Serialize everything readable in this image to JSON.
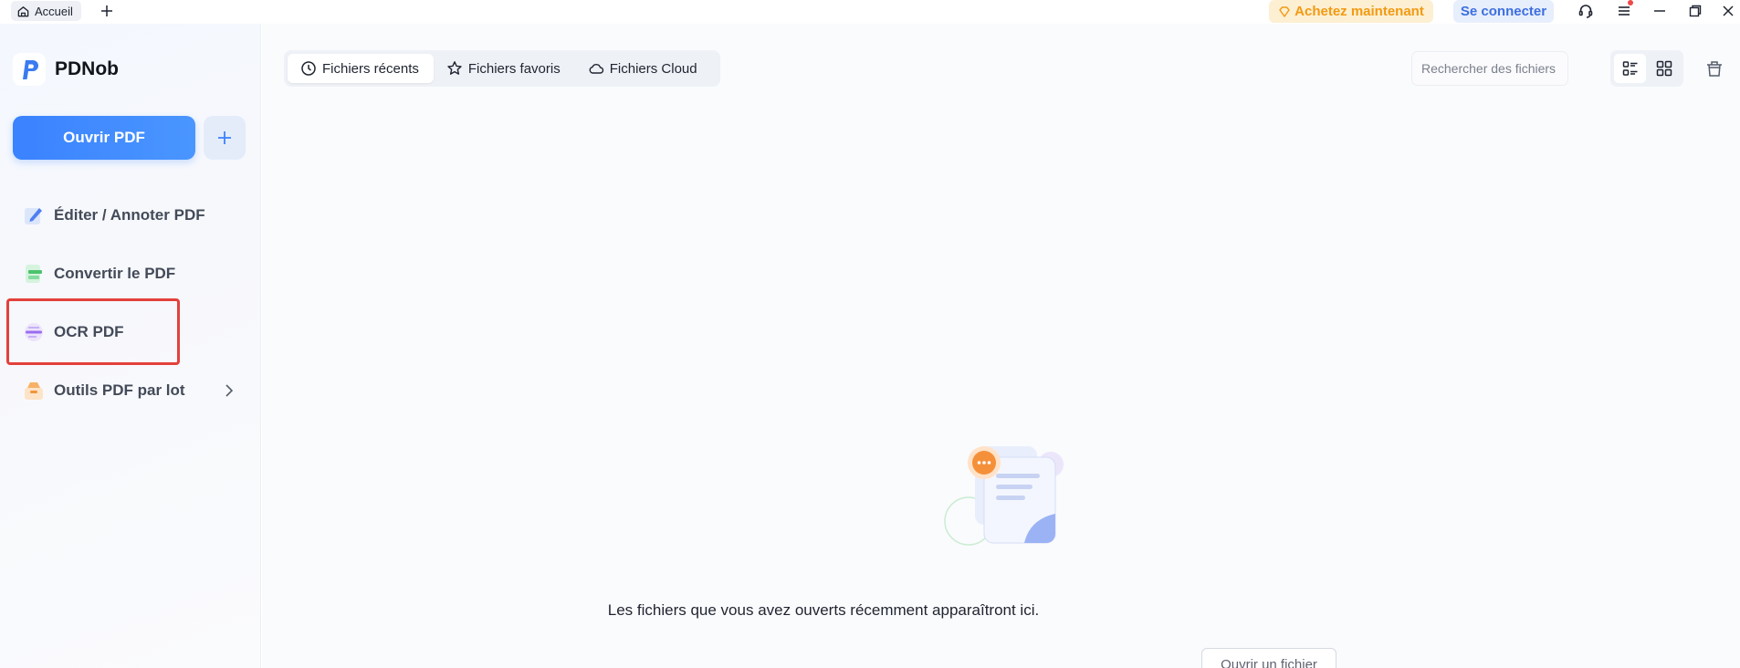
{
  "titlebar": {
    "home_tab_label": "Accueil",
    "buy_label": "Achetez maintenant",
    "login_label": "Se connecter"
  },
  "sidebar": {
    "app_name": "PDNob",
    "open_pdf_label": "Ouvrir PDF",
    "items": [
      {
        "label": "Éditer / Annoter PDF",
        "icon": "edit-icon"
      },
      {
        "label": "Convertir le PDF",
        "icon": "convert-icon"
      },
      {
        "label": "OCR PDF",
        "icon": "ocr-icon"
      },
      {
        "label": "Outils PDF par lot",
        "icon": "batch-icon"
      }
    ]
  },
  "main": {
    "tabs": [
      {
        "label": "Fichiers récents",
        "icon": "clock-icon",
        "active": true
      },
      {
        "label": "Fichiers favoris",
        "icon": "star-icon",
        "active": false
      },
      {
        "label": "Fichiers Cloud",
        "icon": "cloud-icon",
        "active": false
      }
    ],
    "search_placeholder": "Rechercher des fichiers",
    "empty_message": "Les fichiers que vous avez ouverts récemment apparaîtront ici.",
    "open_file_label": "Ouvrir un fichier"
  },
  "colors": {
    "accent": "#3a82ff",
    "buy": "#f29a12",
    "login": "#3d6fe0",
    "highlight": "#e4403c"
  }
}
